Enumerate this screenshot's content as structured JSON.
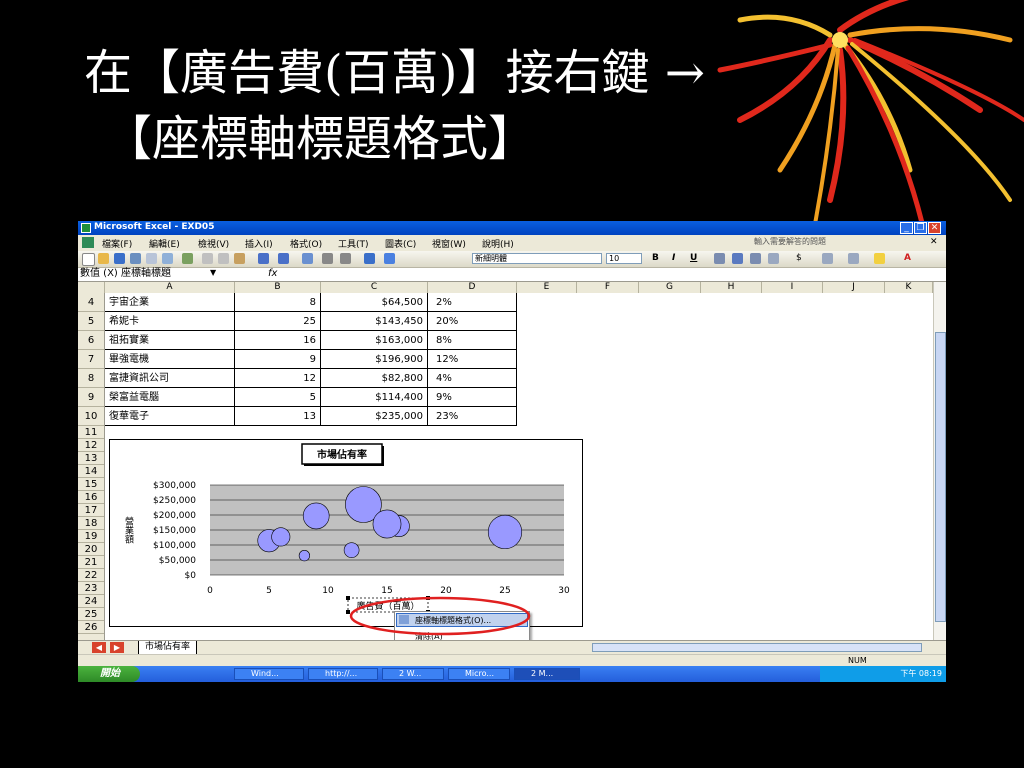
{
  "slide": {
    "title_line1": "在【廣告費(百萬)】接右鍵 →",
    "title_line2": "【座標軸標題格式】"
  },
  "excel": {
    "window_title": "Microsoft Excel - EXD05",
    "menus": [
      "檔案(F)",
      "編輯(E)",
      "檢視(V)",
      "插入(I)",
      "格式(O)",
      "工具(T)",
      "圖表(C)",
      "視窗(W)",
      "說明(H)"
    ],
    "help_placeholder": "輸入需要解答的問題",
    "font_name": "新細明體",
    "font_size": "10",
    "name_box": "數值 (X) 座標軸標題",
    "fx_label": "fx",
    "columns": [
      "A",
      "B",
      "C",
      "D",
      "E",
      "F",
      "G",
      "H",
      "I",
      "J",
      "K"
    ],
    "row_numbers": [
      "4",
      "5",
      "6",
      "7",
      "8",
      "9",
      "10",
      "11",
      "12",
      "13",
      "14",
      "15",
      "16",
      "17",
      "18",
      "19",
      "20",
      "21",
      "22",
      "23",
      "24",
      "25",
      "26"
    ],
    "table_rows": [
      {
        "name": "宇宙企業",
        "b": "8",
        "c": "$64,500",
        "d": "2%"
      },
      {
        "name": "希妮卡",
        "b": "25",
        "c": "$143,450",
        "d": "20%"
      },
      {
        "name": "祖拓實業",
        "b": "16",
        "c": "$163,000",
        "d": "8%"
      },
      {
        "name": "畢強電機",
        "b": "9",
        "c": "$196,900",
        "d": "12%"
      },
      {
        "name": "富捷資訊公司",
        "b": "12",
        "c": "$82,800",
        "d": "4%"
      },
      {
        "name": "榮富益電腦",
        "b": "5",
        "c": "$114,400",
        "d": "9%"
      },
      {
        "name": "復華電子",
        "b": "13",
        "c": "$235,000",
        "d": "23%"
      }
    ],
    "context_menu": {
      "item1": "座標軸標題格式(O)...",
      "item2": "清除(A)"
    },
    "sheet_tab": "市場佔有率",
    "status_text": "NUM",
    "start_label": "開始",
    "taskbar_items": [
      "Wind...",
      "http://...",
      "2 W...",
      "Micro...",
      "2 M..."
    ],
    "clock": "下午 08:19"
  },
  "chart_data": {
    "type": "scatter",
    "title": "市場佔有率",
    "xlabel": "廣告費（百萬）",
    "ylabel": "營業額",
    "x_ticks": [
      "0",
      "5",
      "10",
      "15",
      "20",
      "25",
      "30"
    ],
    "y_ticks": [
      "$0",
      "$50,000",
      "$100,000",
      "$150,000",
      "$200,000",
      "$250,000",
      "$300,000"
    ],
    "xlim": [
      0,
      30
    ],
    "ylim": [
      0,
      300000
    ],
    "points": [
      {
        "x": 8,
        "y": 64500,
        "size": 2
      },
      {
        "x": 25,
        "y": 143450,
        "size": 20
      },
      {
        "x": 16,
        "y": 163000,
        "size": 8
      },
      {
        "x": 9,
        "y": 196900,
        "size": 12
      },
      {
        "x": 12,
        "y": 82800,
        "size": 4
      },
      {
        "x": 5,
        "y": 114400,
        "size": 9
      },
      {
        "x": 13,
        "y": 235000,
        "size": 23
      },
      {
        "x": 6,
        "y": 127000,
        "size": 6
      },
      {
        "x": 15,
        "y": 170000,
        "size": 14
      }
    ],
    "bubble_color": "#9999FF",
    "plot_bg": "#C0C0C0",
    "grid": true,
    "legend": "none"
  }
}
